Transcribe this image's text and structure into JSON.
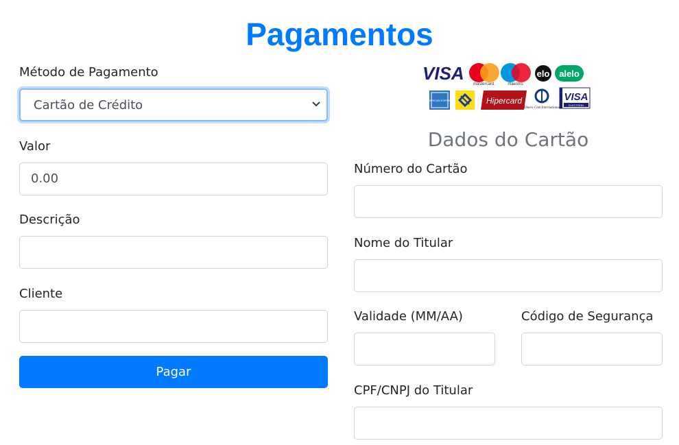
{
  "page": {
    "title": "Pagamentos"
  },
  "form": {
    "payment_method_label": "Método de Pagamento",
    "payment_method_value": "Cartão de Crédito",
    "amount_label": "Valor",
    "amount_value": "0.00",
    "description_label": "Descrição",
    "client_label": "Cliente",
    "pay_button": "Pagar"
  },
  "card": {
    "section_title": "Dados do Cartão",
    "number_label": "Número do Cartão",
    "holder_label": "Nome do Titular",
    "expiry_label": "Validade (MM/AA)",
    "cvv_label": "Código de Segurança",
    "doc_label": "CPF/CNPJ do Titular",
    "brands": {
      "visa": "VISA",
      "mastercard": "mastercard.",
      "maestro": "maestro.",
      "elo": "elo",
      "alelo": "alelo",
      "amex": "AMERICAN EXPRESS",
      "hipercard": "Hipercard",
      "diners": "Diners Club International",
      "visa_electron": "VISA",
      "visa_electron_sub": "ELECTRON"
    }
  },
  "colors": {
    "accent": "#007bff",
    "focus_border": "#80bdff",
    "muted": "#6c757d"
  }
}
